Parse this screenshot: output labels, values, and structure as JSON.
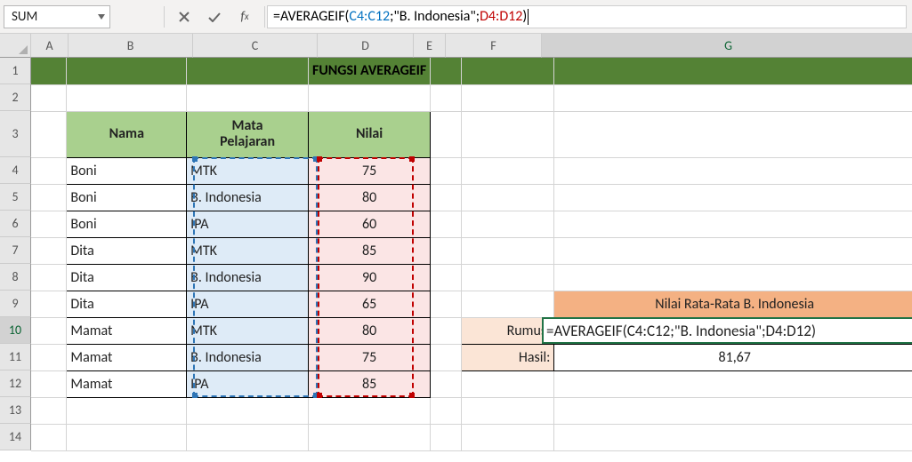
{
  "namebox": "SUM",
  "formula": {
    "eq": "=",
    "func": "AVERAGEIF",
    "open": "(",
    "range1": "C4:C12",
    "sep1": ";",
    "str": "\"B. Indonesia\"",
    "sep2": ";",
    "range2": "D4:D12",
    "close": ")"
  },
  "columns": [
    "A",
    "B",
    "C",
    "D",
    "E",
    "F",
    "G"
  ],
  "rows": [
    "1",
    "2",
    "3",
    "4",
    "5",
    "6",
    "7",
    "8",
    "9",
    "10",
    "11",
    "12",
    "13",
    "14"
  ],
  "title": "FUNGSI AVERAGEIF",
  "headers": {
    "nama": "Nama",
    "mapel": "Mata\nPelajaran",
    "nilai": "Nilai"
  },
  "data": [
    {
      "nama": "Boni",
      "mapel": "MTK",
      "nilai": "75"
    },
    {
      "nama": "Boni",
      "mapel": "B. Indonesia",
      "nilai": "80"
    },
    {
      "nama": "Boni",
      "mapel": "IPA",
      "nilai": "60"
    },
    {
      "nama": "Dita",
      "mapel": "MTK",
      "nilai": "85"
    },
    {
      "nama": "Dita",
      "mapel": "B. Indonesia",
      "nilai": "90"
    },
    {
      "nama": "Dita",
      "mapel": "IPA",
      "nilai": "65"
    },
    {
      "nama": "Mamat",
      "mapel": "MTK",
      "nilai": "80"
    },
    {
      "nama": "Mamat",
      "mapel": "B. Indonesia",
      "nilai": "75"
    },
    {
      "nama": "Mamat",
      "mapel": "IPA",
      "nilai": "85"
    }
  ],
  "result": {
    "header": "Nilai Rata-Rata B. Indonesia",
    "rumus_label": "Rumus:",
    "rumus_value": "=AVERAGEIF(C4:C12;\"B. Indonesia\";D4:D12)",
    "hasil_label": "Hasil:",
    "hasil_value": "81,67"
  },
  "chart_data": {
    "type": "table",
    "title": "FUNGSI AVERAGEIF",
    "columns": [
      "Nama",
      "Mata Pelajaran",
      "Nilai"
    ],
    "rows": [
      [
        "Boni",
        "MTK",
        75
      ],
      [
        "Boni",
        "B. Indonesia",
        80
      ],
      [
        "Boni",
        "IPA",
        60
      ],
      [
        "Dita",
        "MTK",
        85
      ],
      [
        "Dita",
        "B. Indonesia",
        90
      ],
      [
        "Dita",
        "IPA",
        65
      ],
      [
        "Mamat",
        "MTK",
        80
      ],
      [
        "Mamat",
        "B. Indonesia",
        75
      ],
      [
        "Mamat",
        "IPA",
        85
      ]
    ],
    "summary": {
      "label": "Nilai Rata-Rata B. Indonesia",
      "formula": "=AVERAGEIF(C4:C12;\"B. Indonesia\";D4:D12)",
      "value": 81.67
    }
  }
}
